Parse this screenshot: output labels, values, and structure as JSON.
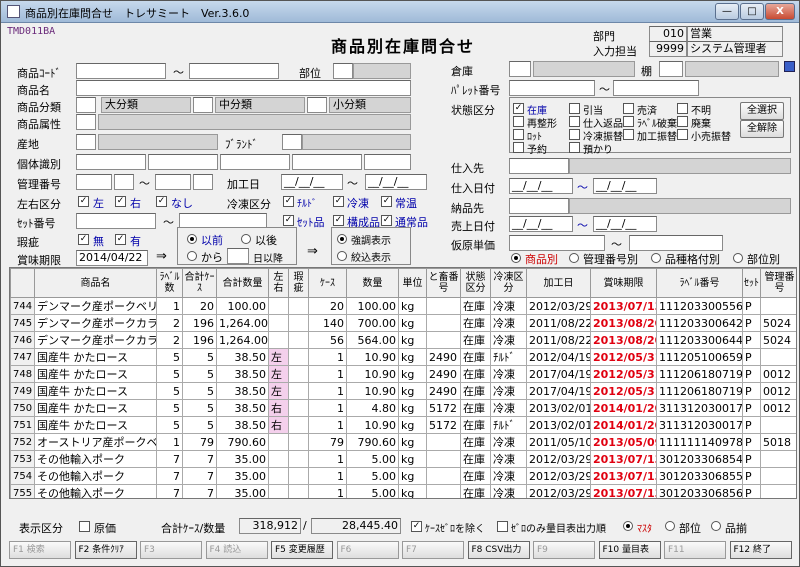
{
  "window": {
    "title": "商品別在庫問合せ　トレサミート　Ver.3.6.0",
    "min": "—",
    "max": "□",
    "close": "X"
  },
  "header": {
    "program_id": "TMD011BA",
    "form_title": "商品別在庫問合せ",
    "dept_label": "部門",
    "dept_code": "010",
    "dept_name": "営業",
    "staff_label": "入力担当",
    "staff_code": "9999",
    "staff_name": "システム管理者"
  },
  "filters": {
    "product_code": "商品ｺｰﾄﾞ",
    "tilde": "～",
    "section": "部位",
    "product_name": "商品名",
    "category": "商品分類",
    "cat_large": "大分類",
    "cat_mid": "中分類",
    "cat_small": "小分類",
    "attribute": "商品属性",
    "origin": "産地",
    "brand": "ﾌﾞﾗﾝﾄﾞ",
    "individual": "個体識別",
    "mgmt_no": "管理番号",
    "proc_date": "加工日",
    "date_blank": "__/__/__",
    "lr_label": "左右区分",
    "lr_left": "左",
    "lr_right": "右",
    "lr_none": "なし",
    "cool_label": "冷凍区分",
    "cool_chilled": "ﾁﾙﾄﾞ",
    "cool_frozen": "冷凍",
    "cool_normal": "常温",
    "set_no": "ｾｯﾄ番号",
    "set_item": "ｾｯﾄ品",
    "component": "構成品",
    "normal_item": "通常品",
    "defect_label": "瑕疵",
    "defect_none": "無",
    "defect_yes": "有",
    "expiry_label": "賞味期限",
    "expiry_value": "2014/04/22",
    "arrow": "⇒",
    "before": "以前",
    "after": "以後",
    "from": "から",
    "days_label": "日以降",
    "arrow2": "⇒",
    "highlight": "強調表示",
    "narrow": "絞込表示"
  },
  "right_filters": {
    "warehouse": "倉庫",
    "shelf": "棚",
    "pallet": "ﾊﾟﾚｯﾄ番号",
    "status_label": "状態区分",
    "statuses": [
      "在庫",
      "引当",
      "売済",
      "不明",
      "再整形",
      "仕入返品",
      "ﾗﾍﾞﾙ破棄",
      "廃棄",
      "ﾛｯﾄ",
      "冷凍振替",
      "加工振替",
      "小売振替",
      "予約",
      "預かり"
    ],
    "select_all": "全選択",
    "clear_all": "全解除",
    "supplier": "仕入先",
    "purchase_date": "仕入日付",
    "delivery": "納品先",
    "sales_date": "売上日付",
    "temp_price": "仮原単価",
    "date_blank": "__/__/__",
    "tilde": "～",
    "view_product": "商品別",
    "view_mgmt": "管理番号別",
    "view_type": "品種格付別",
    "view_section": "部位別",
    "export_icon": "export-icon"
  },
  "table": {
    "headers": [
      "",
      "商品名",
      "ﾗﾍﾞﾙ数",
      "合計ｹｰｽ",
      "合計数量",
      "左右",
      "瑕疵",
      "ｹｰｽ",
      "数量",
      "単位",
      "と畜番号",
      "状態区分",
      "冷凍区分",
      "加工日",
      "賞味期限",
      "ﾗﾍﾞﾙ番号",
      "ｾｯﾄ",
      "管理番号"
    ],
    "rows": [
      [
        "744",
        "デンマーク産ポークベリ",
        "1",
        "20",
        "100.00",
        "",
        "",
        "20",
        "100.00",
        "kg",
        "",
        "在庫",
        "冷凍",
        "2012/03/29",
        "2013/07/13",
        "111203300556",
        "P",
        ""
      ],
      [
        "745",
        "デンマーク産ポークカラ",
        "2",
        "196",
        "1,264.00",
        "",
        "",
        "140",
        "700.00",
        "kg",
        "",
        "在庫",
        "冷凍",
        "2011/08/22",
        "2013/08/20",
        "111203300642",
        "P",
        "5024"
      ],
      [
        "746",
        "デンマーク産ポークカラ",
        "2",
        "196",
        "1,264.00",
        "",
        "",
        "56",
        "564.00",
        "kg",
        "",
        "在庫",
        "冷凍",
        "2011/08/22",
        "2013/08/20",
        "111203300644",
        "P",
        "5024"
      ],
      [
        "747",
        "国産牛 かたロース",
        "5",
        "5",
        "38.50",
        "左",
        "",
        "1",
        "10.90",
        "kg",
        "2490",
        "在庫",
        "ﾁﾙﾄﾞ",
        "2012/04/19",
        "2012/05/31",
        "111205100659",
        "P",
        ""
      ],
      [
        "748",
        "国産牛 かたロース",
        "5",
        "5",
        "38.50",
        "左",
        "",
        "1",
        "10.90",
        "kg",
        "2490",
        "在庫",
        "冷凍",
        "2017/04/19",
        "2012/05/31",
        "111206180719",
        "P",
        "0012"
      ],
      [
        "749",
        "国産牛 かたロース",
        "5",
        "5",
        "38.50",
        "左",
        "",
        "1",
        "10.90",
        "kg",
        "2490",
        "在庫",
        "冷凍",
        "2017/04/19",
        "2012/05/31",
        "111206180719",
        "P",
        "0012"
      ],
      [
        "750",
        "国産牛 かたロース",
        "5",
        "5",
        "38.50",
        "右",
        "",
        "1",
        "4.80",
        "kg",
        "5172",
        "在庫",
        "冷凍",
        "2013/02/01",
        "2014/01/20",
        "311312030017",
        "P",
        "0012"
      ],
      [
        "751",
        "国産牛 かたロース",
        "5",
        "5",
        "38.50",
        "右",
        "",
        "1",
        "10.90",
        "kg",
        "5172",
        "在庫",
        "ﾁﾙﾄﾞ",
        "2013/02/01",
        "2014/01/20",
        "311312030017",
        "P",
        ""
      ],
      [
        "752",
        "オーストリア産ポークベ",
        "1",
        "79",
        "790.60",
        "",
        "",
        "79",
        "790.60",
        "kg",
        "",
        "在庫",
        "冷凍",
        "2011/05/10",
        "2013/05/09",
        "111111140978",
        "P",
        "5018"
      ],
      [
        "753",
        "その他輸入ポーク",
        "7",
        "7",
        "35.00",
        "",
        "",
        "1",
        "5.00",
        "kg",
        "",
        "在庫",
        "冷凍",
        "2012/03/29",
        "2013/07/13",
        "301203306854",
        "P",
        ""
      ],
      [
        "754",
        "その他輸入ポーク",
        "7",
        "7",
        "35.00",
        "",
        "",
        "1",
        "5.00",
        "kg",
        "",
        "在庫",
        "冷凍",
        "2012/03/29",
        "2013/07/13",
        "301203306855",
        "P",
        ""
      ],
      [
        "755",
        "その他輸入ポーク",
        "7",
        "7",
        "35.00",
        "",
        "",
        "1",
        "5.00",
        "kg",
        "",
        "在庫",
        "冷凍",
        "2012/03/29",
        "2013/07/13",
        "301203306856",
        "P",
        ""
      ]
    ]
  },
  "footer": {
    "display_label": "表示区分",
    "original_price": "原価",
    "total_label": "合計ｹｰｽ/数量",
    "total_case": "318,912",
    "slash": "/",
    "total_qty": "28,445.40",
    "hide_zero": "ｹｰｽｾﾞﾛを除く",
    "zero_only": "ｾﾞﾛのみ量目表出力順",
    "order_master": "ﾏｽﾀ",
    "order_section": "部位",
    "order_brand": "品揃"
  },
  "fkeys": [
    "F1 検索",
    "F2 条件ｸﾘｱ",
    "F3",
    "F4 読込",
    "F5 変更履歴",
    "F6",
    "F7",
    "F8 CSV出力",
    "F9",
    "F10 量目表",
    "F11",
    "F12 終了"
  ],
  "colors": {
    "accent_red": "#e00010",
    "link_blue": "#0000aa",
    "pink_cell": "#f4d0ec"
  }
}
